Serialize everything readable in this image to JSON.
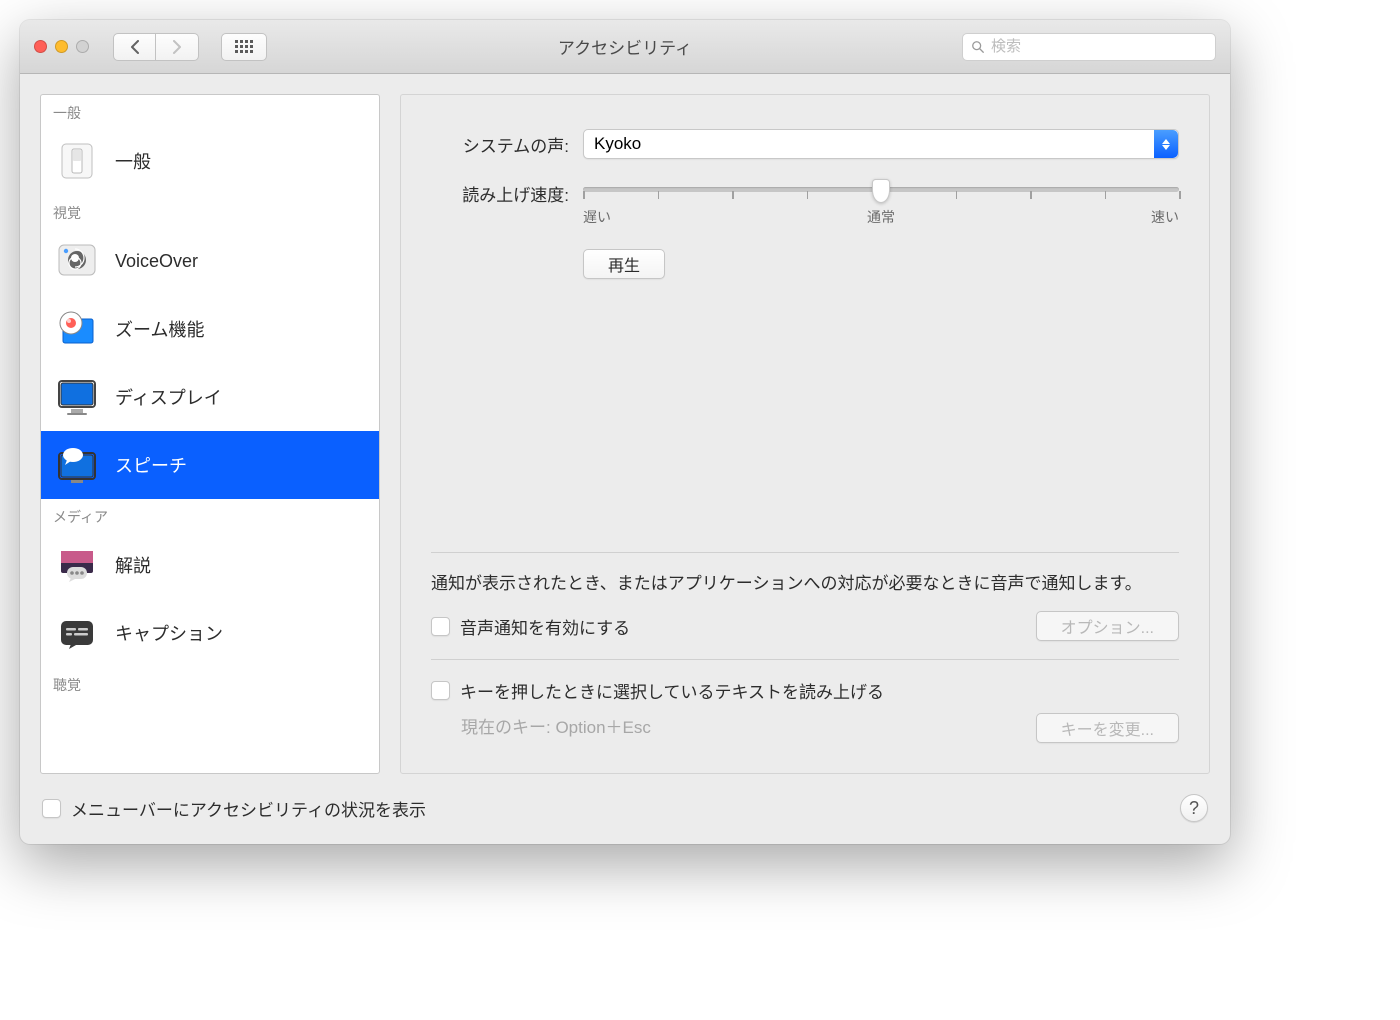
{
  "window": {
    "title": "アクセシビリティ",
    "search_placeholder": "検索"
  },
  "sidebar": {
    "groups": [
      {
        "header": "一般",
        "items": [
          {
            "label": "一般",
            "icon": "general"
          }
        ]
      },
      {
        "header": "視覚",
        "items": [
          {
            "label": "VoiceOver",
            "icon": "voiceover"
          },
          {
            "label": "ズーム機能",
            "icon": "zoom"
          },
          {
            "label": "ディスプレイ",
            "icon": "display"
          },
          {
            "label": "スピーチ",
            "icon": "speech",
            "selected": true
          }
        ]
      },
      {
        "header": "メディア",
        "items": [
          {
            "label": "解説",
            "icon": "descriptions"
          },
          {
            "label": "キャプション",
            "icon": "captions"
          }
        ]
      },
      {
        "header": "聴覚",
        "items": []
      }
    ]
  },
  "main": {
    "voice_label": "システムの声:",
    "voice_value": "Kyoko",
    "rate_label": "読み上げ速度:",
    "rate_ticks": {
      "slow": "遅い",
      "normal": "通常",
      "fast": "速い"
    },
    "rate_value": 50,
    "play_button": "再生",
    "announce_desc": "通知が表示されたとき、またはアプリケーションへの対応が必要なときに音声で通知します。",
    "announce_checkbox": "音声通知を有効にする",
    "options_button": "オプション...",
    "speak_selection_checkbox": "キーを押したときに選択しているテキストを読み上げる",
    "current_key_label": "現在のキー: Option＋Esc",
    "change_key_button": "キーを変更..."
  },
  "footer": {
    "menubar_checkbox": "メニューバーにアクセシビリティの状況を表示",
    "help": "?"
  }
}
